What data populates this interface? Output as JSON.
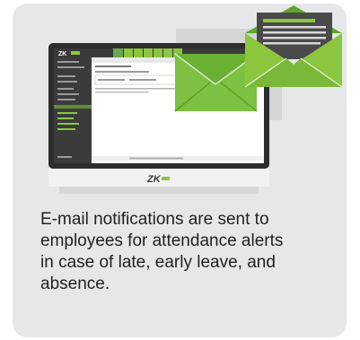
{
  "card": {
    "background_color": "#e6e7e8",
    "accent_color": "#8cc63f",
    "caption_lines": [
      "E-mail notifications are sent to",
      "employees for attendance alerts",
      "in case of late, early leave, and",
      "absence."
    ]
  },
  "monitor": {
    "app_logo": "ZK",
    "brand_logo": "ZK"
  },
  "icons": {
    "front_envelope": "open-envelope-with-document-icon",
    "back_envelope": "closed-envelope-icon"
  }
}
